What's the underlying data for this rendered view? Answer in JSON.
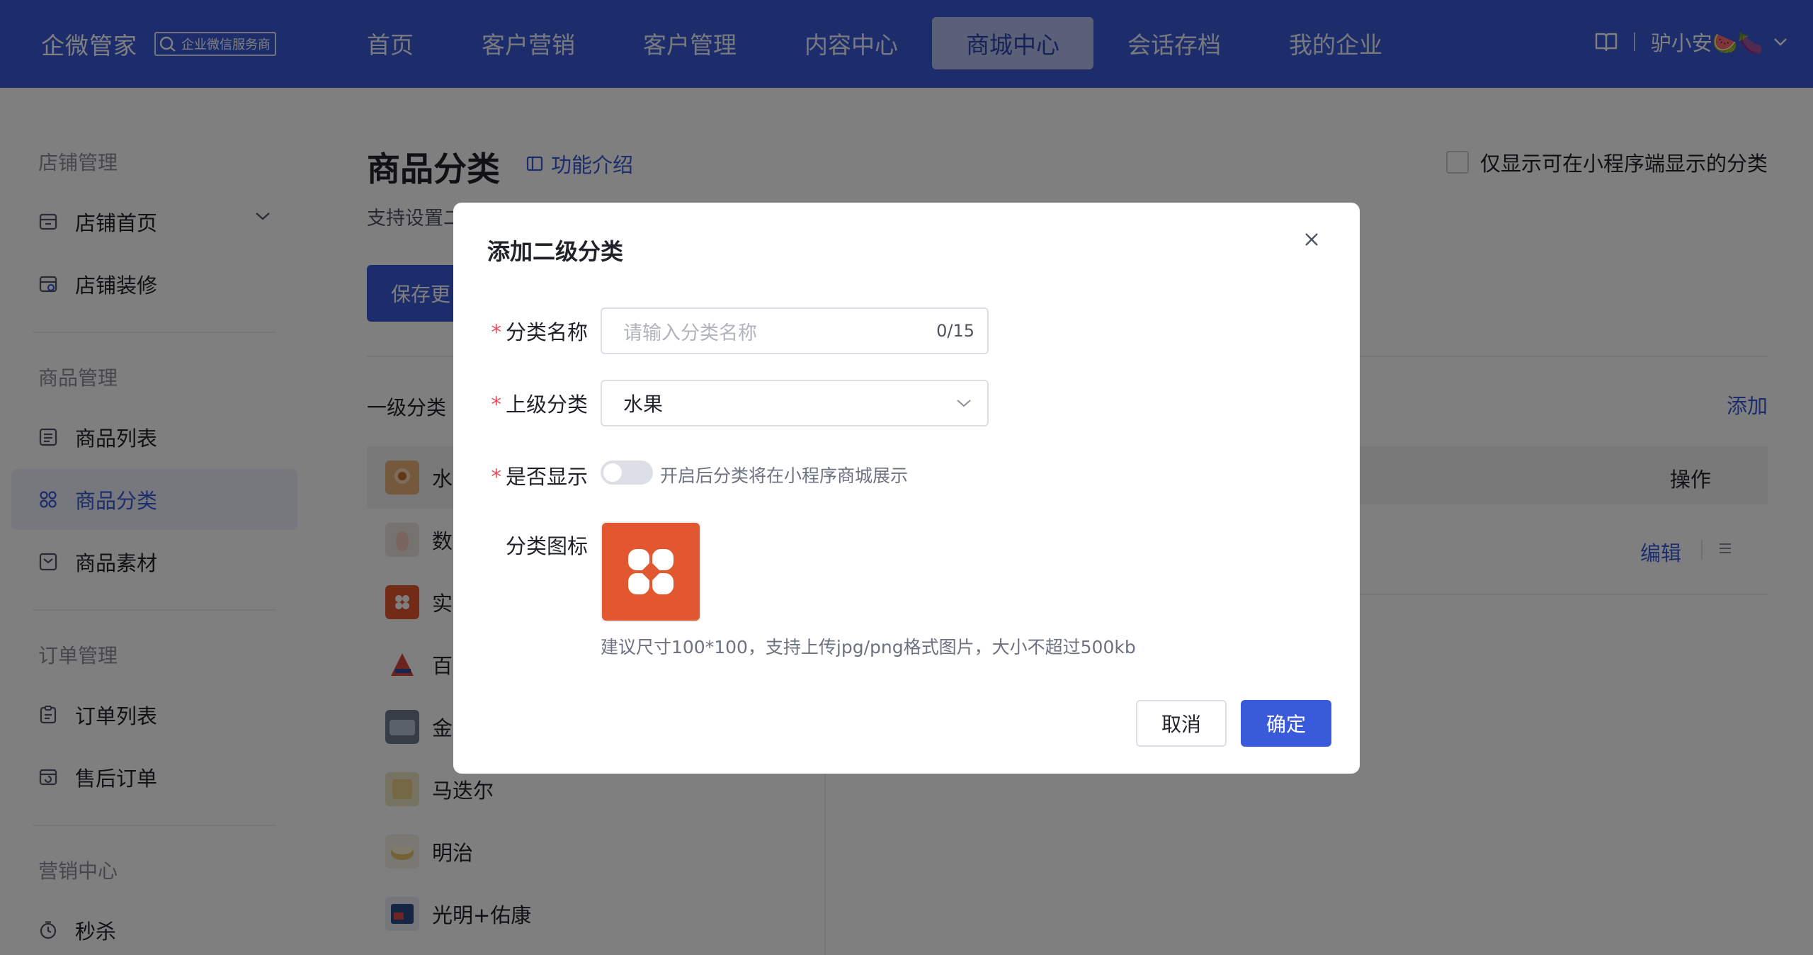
{
  "brand": {
    "name": "企微管家",
    "badge": "企业微信服务商"
  },
  "nav": [
    {
      "label": "首页"
    },
    {
      "label": "客户营销"
    },
    {
      "label": "客户管理"
    },
    {
      "label": "内容中心"
    },
    {
      "label": "商城中心",
      "active": true
    },
    {
      "label": "会话存档"
    },
    {
      "label": "我的企业"
    }
  ],
  "user": {
    "name": "驴小安🍉🍆"
  },
  "sidebar": {
    "groups": [
      "店铺管理",
      "商品管理",
      "订单管理",
      "营销中心"
    ],
    "items": [
      {
        "label": "店铺首页"
      },
      {
        "label": "店铺装修"
      },
      {
        "label": "商品列表"
      },
      {
        "label": "商品分类",
        "active": true
      },
      {
        "label": "商品素材"
      },
      {
        "label": "订单列表"
      },
      {
        "label": "售后订单"
      },
      {
        "label": "秒杀"
      }
    ]
  },
  "page": {
    "title": "商品分类",
    "intro_link": "功能介绍",
    "only_show_label": "仅显示可在小程序端显示的分类",
    "desc": "支持设置二",
    "save_button": "保存更",
    "level1_label": "一级分类",
    "add_link": "添加",
    "table_op_header": "操作",
    "edit_link": "编辑",
    "categories": [
      {
        "name": "水果"
      },
      {
        "name": "数码"
      },
      {
        "name": "实用"
      },
      {
        "name": "百货"
      },
      {
        "name": "金龙"
      },
      {
        "name": "马迭尔"
      },
      {
        "name": "明治"
      },
      {
        "name": "光明+佑康"
      }
    ]
  },
  "modal": {
    "title": "添加二级分类",
    "name_label": "分类名称",
    "name_placeholder": "请输入分类名称",
    "name_counter": "0/15",
    "parent_label": "上级分类",
    "parent_value": "水果",
    "show_label": "是否显示",
    "show_enabled": false,
    "show_hint": "开启后分类将在小程序商城展示",
    "icon_label": "分类图标",
    "icon_hint": "建议尺寸100*100，支持上传jpg/png格式图片，大小不超过500kb",
    "cancel_button": "取消",
    "ok_button": "确定"
  },
  "colors": {
    "primary": "#3a5bd9",
    "required": "#e34d59",
    "icon_tile": "#e2572f"
  }
}
